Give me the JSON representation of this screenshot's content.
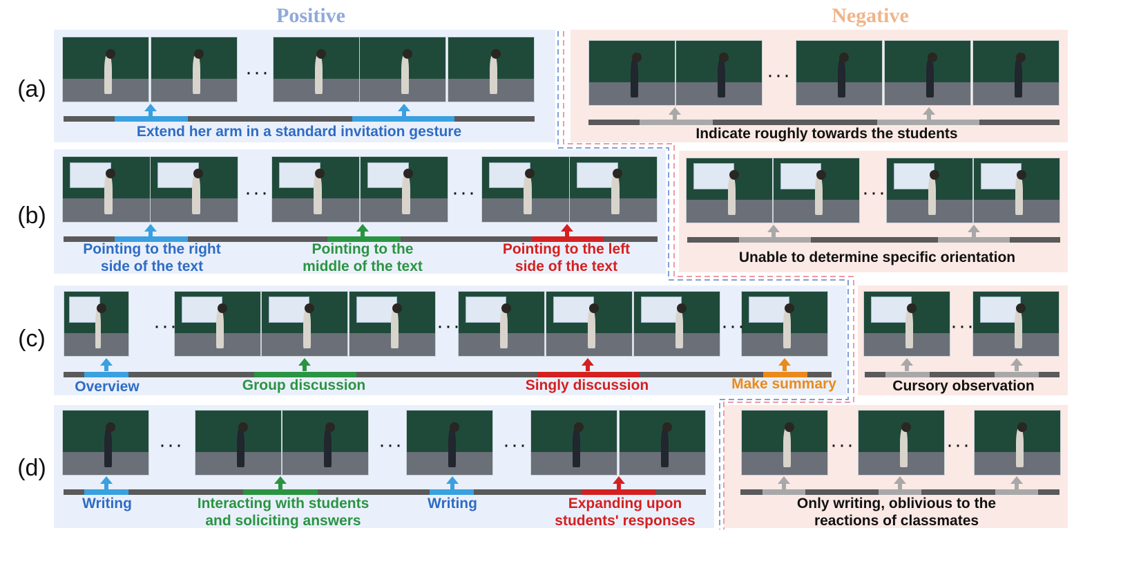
{
  "headers": {
    "positive": "Positive",
    "negative": "Negative"
  },
  "rows": [
    {
      "label": "(a)",
      "positive": [
        {
          "text": "Extend her arm in a standard invitation gesture",
          "color": "blue"
        }
      ],
      "negative": [
        {
          "text": "Indicate roughly towards the students",
          "color": "black"
        }
      ]
    },
    {
      "label": "(b)",
      "positive": [
        {
          "text": "Pointing to the right side of the text",
          "line1": "Pointing to the right",
          "line2": "side of the text",
          "color": "blue"
        },
        {
          "text": "Pointing to the middle of the text",
          "line1": "Pointing to the",
          "line2": "middle of the text",
          "color": "green"
        },
        {
          "text": "Pointing to the left side of the text",
          "line1": "Pointing to the left",
          "line2": "side of the text",
          "color": "red"
        }
      ],
      "negative": [
        {
          "text": "Unable to determine specific orientation",
          "color": "black"
        }
      ]
    },
    {
      "label": "(c)",
      "positive": [
        {
          "text": "Overview",
          "color": "blue"
        },
        {
          "text": "Group discussion",
          "color": "green"
        },
        {
          "text": "Singly discussion",
          "color": "red"
        },
        {
          "text": "Make summary",
          "color": "orange"
        }
      ],
      "negative": [
        {
          "text": "Cursory observation",
          "color": "black"
        }
      ]
    },
    {
      "label": "(d)",
      "positive": [
        {
          "text": "Writing",
          "color": "blue"
        },
        {
          "text": "Interacting with students and soliciting answers",
          "line1": "Interacting with students",
          "line2": "and soliciting answers",
          "color": "green"
        },
        {
          "text": "Writing",
          "color": "blue"
        },
        {
          "text": "Expanding upon students' responses",
          "line1": "Expanding upon",
          "line2": "students' responses",
          "color": "red"
        }
      ],
      "negative": [
        {
          "text": "Only writing, oblivious to the reactions of classmates",
          "line1": "Only writing, oblivious to the",
          "line2": "reactions of classmates",
          "color": "black"
        }
      ]
    }
  ],
  "colors": {
    "blue": "#2e6cc4",
    "green": "#2a9442",
    "red": "#d42020",
    "orange": "#ea8a1b",
    "black": "#111111",
    "segBlue": "#3aa0e0",
    "segGreen": "#2a9442",
    "segRed": "#d42020",
    "segOrange": "#ea8a1b",
    "segGray": "#a8a8a8",
    "positiveBg": "#eaf0fb",
    "negativeBg": "#fbe9e5",
    "positiveDash": "#7f9fdc",
    "negativeDash": "#ef9aa6"
  },
  "icons": {
    "marker": "up-arrow-icon",
    "ellipsis": "ellipsis-icon"
  }
}
